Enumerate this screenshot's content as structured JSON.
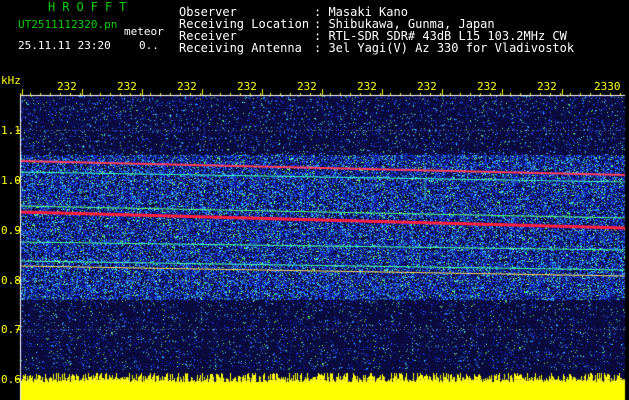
{
  "header": {
    "brand": "HROFFT",
    "filename": "UT2511112320.pn",
    "mode": "meteor",
    "datetime": "25.11.11 23:20",
    "tail": "0..",
    "fields": [
      {
        "label": "Observer",
        "value": ": Masaki Kano"
      },
      {
        "label": "Receiving Location",
        "value": ": Shibukawa, Gunma, Japan"
      },
      {
        "label": "Receiver",
        "value": ": RTL-SDR SDR# 43dB L15 103.2MHz CW"
      },
      {
        "label": "Receiving Antenna",
        "value": ": 3el Yagi(V) Az 330 for Vladivostok"
      }
    ]
  },
  "axis": {
    "y_unit": "kHz",
    "y_ticks": [
      "1.1",
      "1.0",
      "0.9",
      "0.8",
      "0.7",
      "0.6"
    ],
    "x_ticks": [
      "232",
      "232",
      "232",
      "232",
      "232",
      "232",
      "232",
      "232",
      "232",
      "2330"
    ]
  },
  "colors": {
    "text_green": "#00d000",
    "text_white": "#ffffff",
    "axis_yellow": "#ffff00",
    "spectrum_bg": "#0c0c6a",
    "signal_red": "#ff2040"
  }
}
